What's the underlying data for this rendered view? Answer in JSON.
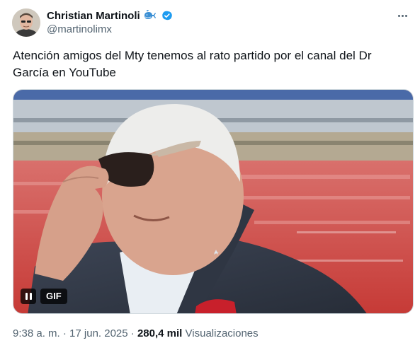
{
  "author": {
    "display_name": "Christian Martinoli",
    "handle": "@martinolimx",
    "badge_icon": "whale-icon",
    "verified": true,
    "verified_color": "#1d9bf0"
  },
  "tweet": {
    "text": "Atención amigos del Mty tenemos  al rato partido por el canal del Dr García en YouTube"
  },
  "media": {
    "type": "gif",
    "badge": "GIF",
    "description_icon": "pause-icon"
  },
  "meta": {
    "time": "9:38 a. m.",
    "sep1": "·",
    "date": "17 jun. 2025",
    "sep2": "·",
    "views_count": "280,4 mil",
    "views_label": "Visualizaciones"
  },
  "colors": {
    "text": "#0f1419",
    "secondary": "#536471",
    "accent": "#1d9bf0"
  }
}
